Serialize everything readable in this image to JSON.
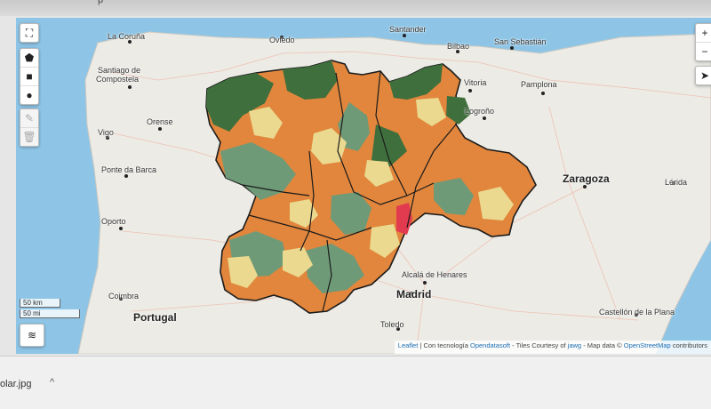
{
  "browser": {
    "crumb": "p"
  },
  "map": {
    "cities": [
      {
        "name": "La Coruña"
      },
      {
        "name": "Oviedo"
      },
      {
        "name": "Santander"
      },
      {
        "name": "Bilbao"
      },
      {
        "name": "San Sebastián"
      },
      {
        "name": "Santiago de"
      },
      {
        "name": "Compostela"
      },
      {
        "name": "Vitoria"
      },
      {
        "name": "Pamplona"
      },
      {
        "name": "Logroño"
      },
      {
        "name": "Orense"
      },
      {
        "name": "Vigo"
      },
      {
        "name": "Zaragoza"
      },
      {
        "name": "Lérida"
      },
      {
        "name": "Ponte da Barca"
      },
      {
        "name": "Oporto"
      },
      {
        "name": "Coimbra"
      },
      {
        "name": "Alcalá de Henares"
      },
      {
        "name": "Madrid"
      },
      {
        "name": "Toledo"
      },
      {
        "name": "Castellón de la Plana"
      },
      {
        "name": "Portugal"
      }
    ],
    "scale": {
      "km": "50 km",
      "mi": "50 mi"
    },
    "attribution": {
      "leaflet": "Leaflet",
      "tech": "| Con tecnología",
      "ods": "Opendatasoft",
      "tiles": "- Tiles Courtesy of",
      "jawg": "jawg",
      "mapdata": "- Map data ©",
      "osm": "OpenStreetMap",
      "contrib": "contributors"
    },
    "colors": {
      "water": "#8ec5e6",
      "land": "#ecebe6",
      "dark_green": "#3f6f3c",
      "mid_green": "#6f9a78",
      "orange": "#e1863c",
      "yellow": "#ead98e",
      "red": "#e23a4f",
      "border": "#1b1b1b"
    },
    "controls": {
      "fullscreen": "fullscreen-icon",
      "polygon": "polygon-icon",
      "square": "square-icon",
      "circle": "circle-icon",
      "edit": "edit-icon",
      "delete": "trash-icon",
      "zoom_in": "+",
      "zoom_out": "−",
      "locate": "locate-icon",
      "layers": "layers-icon"
    }
  },
  "download": {
    "filename": "olar.jpg",
    "chevron": "^"
  }
}
